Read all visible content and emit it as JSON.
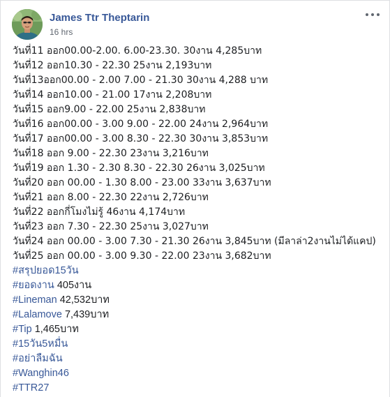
{
  "post": {
    "author": "James Ttr Theptarin",
    "timestamp": "16 hrs",
    "icons": {
      "avatar": "profile-photo",
      "more": "more-options-icon"
    },
    "lines": [
      "วันที่11 ออก00.00-2.00. 6.00-23.30. 30งาน 4,285บาท",
      "วันที่12 ออก10.30 - 22.30 25งาน 2,193บาท",
      "วันที่13ออก00.00 - 2.00 7.00 - 21.30 30งาน 4,288 บาท",
      "วันที่14 ออก10.00 - 21.00 17งาน 2,208บาท",
      "วันที่15 ออก9.00 - 22.00 25งาน 2,838บาท",
      "วันที่16 ออก00.00 - 3.00 9.00 - 22.00 24งาน 2,964บาท",
      "วันที่17 ออก00.00 - 3.00 8.30 - 22.30 30งาน 3,853บาท",
      "วันที่18 ออก 9.00 - 22.30 23งาน 3,216บาท",
      "วันที่19 ออก 1.30 - 2.30 8.30 - 22.30 26งาน 3,025บาท",
      "วันที่20 ออก 00.00 - 1.30 8.00 - 23.00 33งาน 3,637บาท",
      "วันที่21 ออก 8.00 - 22.30 22งาน 2,726บาท",
      "วันที่22 ออกกี่โมงไม่รู้ 46งาน 4,174บาท",
      "วันที่23 ออก 7.30 - 22.30 25งาน 3,027บาท",
      "วันที่24 ออก 00.00 - 3.00 7.30 - 21.30 26งาน 3,845บาท (มีลาล่า2งานไม่ได้แคป)",
      "วันที่25 ออก 00.00 - 3.00 9.30 - 22.00 23งาน 3,682บาท"
    ],
    "tag_lines": [
      {
        "tag": "#สรุปยอด15วัน",
        "text": ""
      },
      {
        "tag": "#ยอดงาน",
        "text": " 405งาน"
      },
      {
        "tag": "#Lineman",
        "text": " 42,532บาท"
      },
      {
        "tag": "#Lalamove",
        "text": " 7,439บาท"
      },
      {
        "tag": "#Tip",
        "text": " 1,465บาท"
      },
      {
        "tag": "#15วัน5หมื่น",
        "text": ""
      },
      {
        "tag": "#อย่าลืมฉัน",
        "text": ""
      },
      {
        "tag": "#Wanghin46",
        "text": ""
      },
      {
        "tag": "#TTR27",
        "text": ""
      }
    ],
    "colors": {
      "link": "#385898",
      "text": "#1c1e21",
      "meta": "#606770"
    }
  }
}
